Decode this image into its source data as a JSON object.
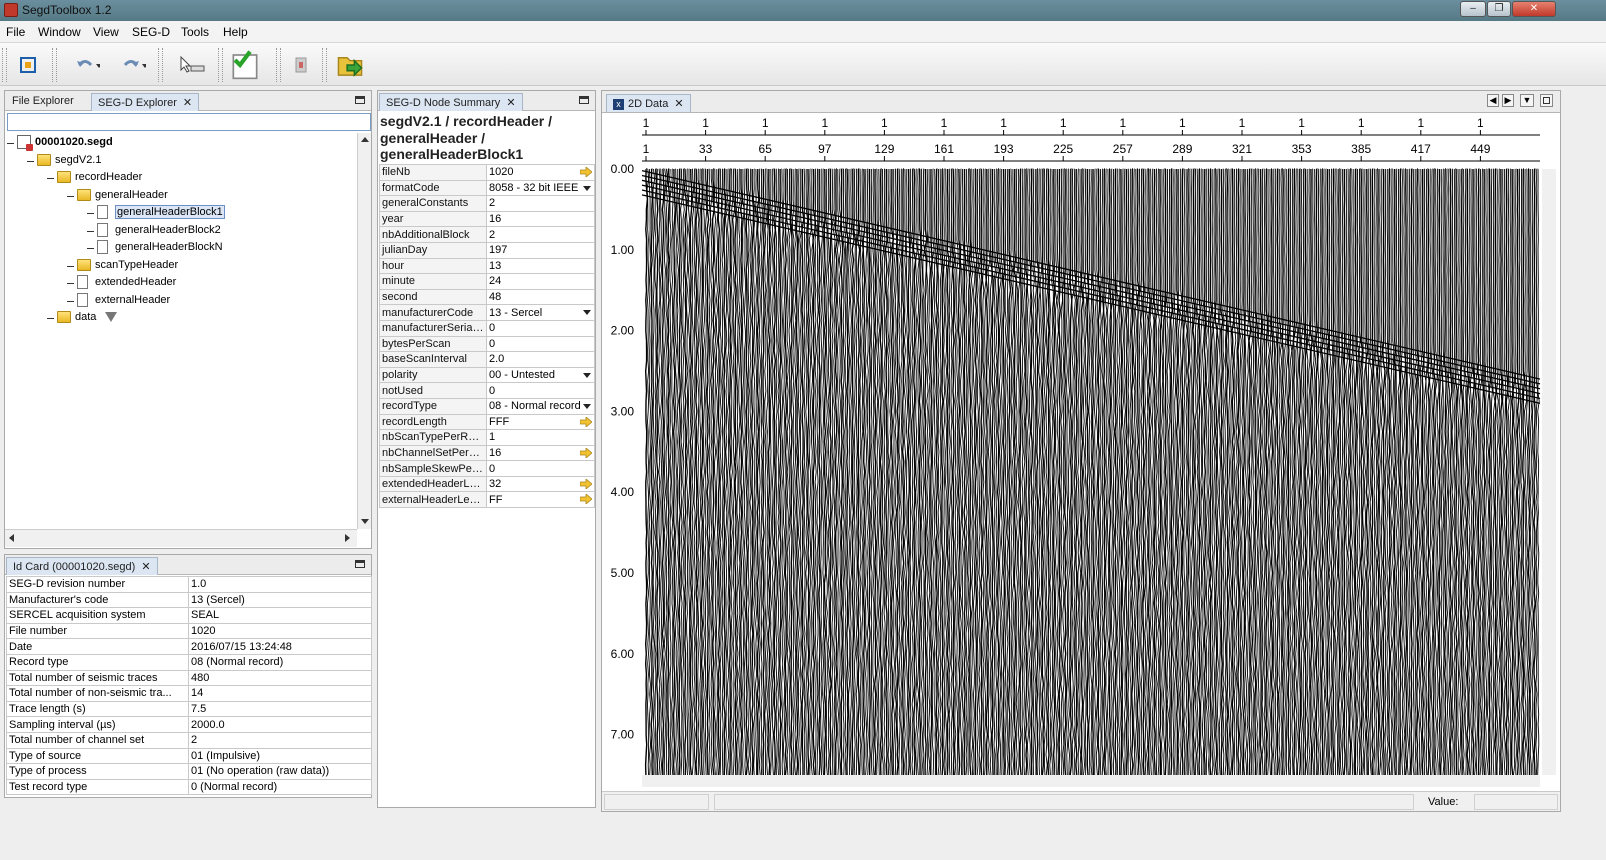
{
  "window": {
    "title": "SegdToolbox 1.2"
  },
  "menu": [
    "File",
    "Window",
    "View",
    "SEG-D",
    "Tools",
    "Help"
  ],
  "toolbar": {
    "icons": [
      "fit-view-icon",
      "undo-icon",
      "redo-icon",
      "measure-pointer-icon",
      "validate-check-icon",
      "clipboard-icon",
      "export-folder-icon"
    ]
  },
  "explorer": {
    "tabs": [
      {
        "label": "File Explorer"
      },
      {
        "label": "SEG-D Explorer"
      }
    ],
    "search_value": "",
    "tree": [
      {
        "label": "00001020.segd",
        "icon": "segd-file-icon",
        "level": 0,
        "bold": true
      },
      {
        "label": "segdV2.1",
        "icon": "folder-icon",
        "level": 1
      },
      {
        "label": "recordHeader",
        "icon": "folder-icon",
        "level": 2
      },
      {
        "label": "generalHeader",
        "icon": "folder-icon",
        "level": 3
      },
      {
        "label": "generalHeaderBlock1",
        "icon": "file-icon",
        "level": 4,
        "selected": true
      },
      {
        "label": "generalHeaderBlock2",
        "icon": "file-icon",
        "level": 4
      },
      {
        "label": "generalHeaderBlockN",
        "icon": "file-icon",
        "level": 4
      },
      {
        "label": "scanTypeHeader",
        "icon": "folder-icon",
        "level": 3
      },
      {
        "label": "extendedHeader",
        "icon": "file-icon",
        "level": 3
      },
      {
        "label": "externalHeader",
        "icon": "file-icon",
        "level": 3
      },
      {
        "label": "data",
        "icon": "folder-icon",
        "level": 2,
        "filter": true
      }
    ]
  },
  "idcard": {
    "tab": "Id Card (00001020.segd)",
    "rows": [
      {
        "key": "SEG-D revision number",
        "value": "1.0"
      },
      {
        "key": "Manufacturer's code",
        "value": "13 (Sercel)"
      },
      {
        "key": "SERCEL acquisition system",
        "value": "SEAL"
      },
      {
        "key": "File number",
        "value": "1020"
      },
      {
        "key": "Date",
        "value": "2016/07/15 13:24:48"
      },
      {
        "key": "Record type",
        "value": "08 (Normal record)"
      },
      {
        "key": "Total number of seismic traces",
        "value": "480"
      },
      {
        "key": "Total number of non-seismic tra...",
        "value": "14"
      },
      {
        "key": "Trace length (s)",
        "value": "7.5"
      },
      {
        "key": "Sampling interval (µs)",
        "value": "2000.0"
      },
      {
        "key": "Total number of channel set",
        "value": "2"
      },
      {
        "key": "Type of source",
        "value": "01 (Impulsive)"
      },
      {
        "key": "Type of process",
        "value": "01 (No operation (raw data))"
      },
      {
        "key": "Test record type",
        "value": "0 (Normal record)"
      }
    ]
  },
  "node_summary": {
    "tab": "SEG-D Node Summary",
    "path_line1": "segdV2.1 / recordHeader /",
    "path_line2": "generalHeader /",
    "path_line3": "generalHeaderBlock1",
    "rows": [
      {
        "key": "fileNb",
        "value": "1020",
        "widget": "go"
      },
      {
        "key": "formatCode",
        "value": "8058 - 32 bit IEEE",
        "widget": "dropdown"
      },
      {
        "key": "generalConstants",
        "value": "2"
      },
      {
        "key": "year",
        "value": "16"
      },
      {
        "key": "nbAdditionalBlock",
        "value": "2"
      },
      {
        "key": "julianDay",
        "value": "197"
      },
      {
        "key": "hour",
        "value": "13"
      },
      {
        "key": "minute",
        "value": "24"
      },
      {
        "key": "second",
        "value": "48"
      },
      {
        "key": "manufacturerCode",
        "value": "13 - Sercel",
        "widget": "dropdown"
      },
      {
        "key": "manufacturerSerialNb",
        "value": "0"
      },
      {
        "key": "bytesPerScan",
        "value": "0"
      },
      {
        "key": "baseScanInterval",
        "value": "2.0"
      },
      {
        "key": "polarity",
        "value": "00 - Untested",
        "widget": "dropdown"
      },
      {
        "key": "notUsed",
        "value": "0"
      },
      {
        "key": "recordType",
        "value": "08 - Normal record",
        "widget": "dropdown"
      },
      {
        "key": "recordLength",
        "value": "FFF",
        "widget": "go"
      },
      {
        "key": "nbScanTypePerRec...",
        "value": "1"
      },
      {
        "key": "nbChannelSetPerSc...",
        "value": "16",
        "widget": "go"
      },
      {
        "key": "nbSampleSkewPerS...",
        "value": "0"
      },
      {
        "key": "extendedHeaderLen...",
        "value": "32",
        "widget": "go"
      },
      {
        "key": "externalHeaderLength",
        "value": "FF",
        "widget": "go"
      }
    ]
  },
  "data_view": {
    "tab": "2D Data",
    "status_value_label": "Value:",
    "status_value": ""
  },
  "chart_data": {
    "type": "heatmap",
    "description_kind": "seismic wiggle trace display",
    "x_top_labels": [
      "1",
      "1",
      "1",
      "1",
      "1",
      "1",
      "1",
      "1",
      "1",
      "1",
      "1",
      "1",
      "1",
      "1",
      "1"
    ],
    "x_labels": [
      "1",
      "33",
      "65",
      "97",
      "129",
      "161",
      "193",
      "225",
      "257",
      "289",
      "321",
      "353",
      "385",
      "417",
      "449"
    ],
    "y_labels": [
      "0.00",
      "1.00",
      "2.00",
      "3.00",
      "4.00",
      "5.00",
      "6.00",
      "7.00"
    ],
    "ylim": [
      0,
      7.5
    ],
    "trace_count": 480,
    "colors": {
      "trace": "#000000",
      "background": "#ffffff"
    }
  }
}
